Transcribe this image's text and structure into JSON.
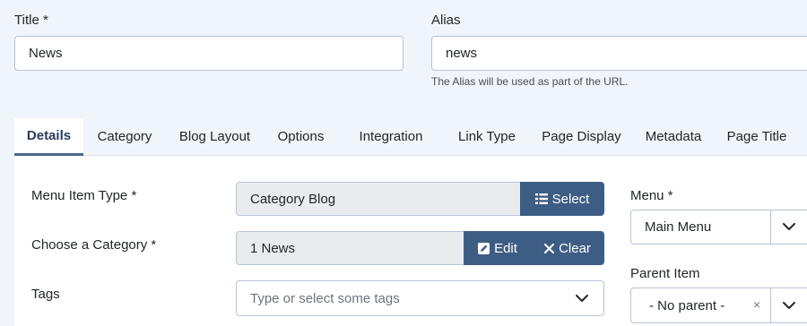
{
  "header": {
    "title_label": "Title *",
    "title_value": "News",
    "alias_label": "Alias",
    "alias_value": "news",
    "alias_help": "The Alias will be used as part of the URL."
  },
  "tabs": [
    {
      "label": "Details",
      "active": true
    },
    {
      "label": "Category"
    },
    {
      "label": "Blog Layout"
    },
    {
      "label": "Options"
    },
    {
      "label": "Integration"
    },
    {
      "label": "Link Type"
    },
    {
      "label": "Page Display"
    },
    {
      "label": "Metadata"
    },
    {
      "label": "Page Title"
    }
  ],
  "details": {
    "menu_item_type_label": "Menu Item Type *",
    "menu_item_type_value": "Category Blog",
    "select_button": "Select",
    "category_label": "Choose a Category *",
    "category_value": "1 News",
    "edit_button": "Edit",
    "clear_button": "Clear",
    "tags_label": "Tags",
    "tags_placeholder": "Type or select some tags"
  },
  "sidebar": {
    "menu_label": "Menu *",
    "menu_value": "Main Menu",
    "parent_label": "Parent Item",
    "parent_value": "- No parent -",
    "parent_clear": "×"
  },
  "colors": {
    "accent": "#3e5d84",
    "tab_active_text": "#2a3a5b",
    "background": "#f0f4fb"
  }
}
